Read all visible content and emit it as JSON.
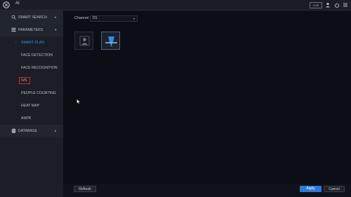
{
  "app": {
    "title": "AI",
    "live_label": "LIVE"
  },
  "sidebar": {
    "smart_search": "SMART SEARCH",
    "parameters": "PARAMETERS",
    "items": [
      {
        "label": "SMART PLAN"
      },
      {
        "label": "FACE DETECTION"
      },
      {
        "label": "FACE RECOGNITION"
      },
      {
        "label": "IVS"
      },
      {
        "label": "PEOPLE COUNTING"
      },
      {
        "label": "HEAT MAP"
      },
      {
        "label": "ANPR"
      }
    ],
    "database": "DATABASE"
  },
  "channel": {
    "label": "Channel",
    "value": "D1"
  },
  "buttons": {
    "refresh": "Refresh",
    "apply": "Apply",
    "cancel": "Cancel"
  },
  "colors": {
    "accent": "#2d7ad8",
    "highlight_box": "#d8232a",
    "active_text": "#3f8ce6"
  },
  "icons": [
    "ai-logo-icon",
    "user-icon",
    "power-icon",
    "menu-icon",
    "face-plan-icon",
    "ivs-plan-icon"
  ]
}
